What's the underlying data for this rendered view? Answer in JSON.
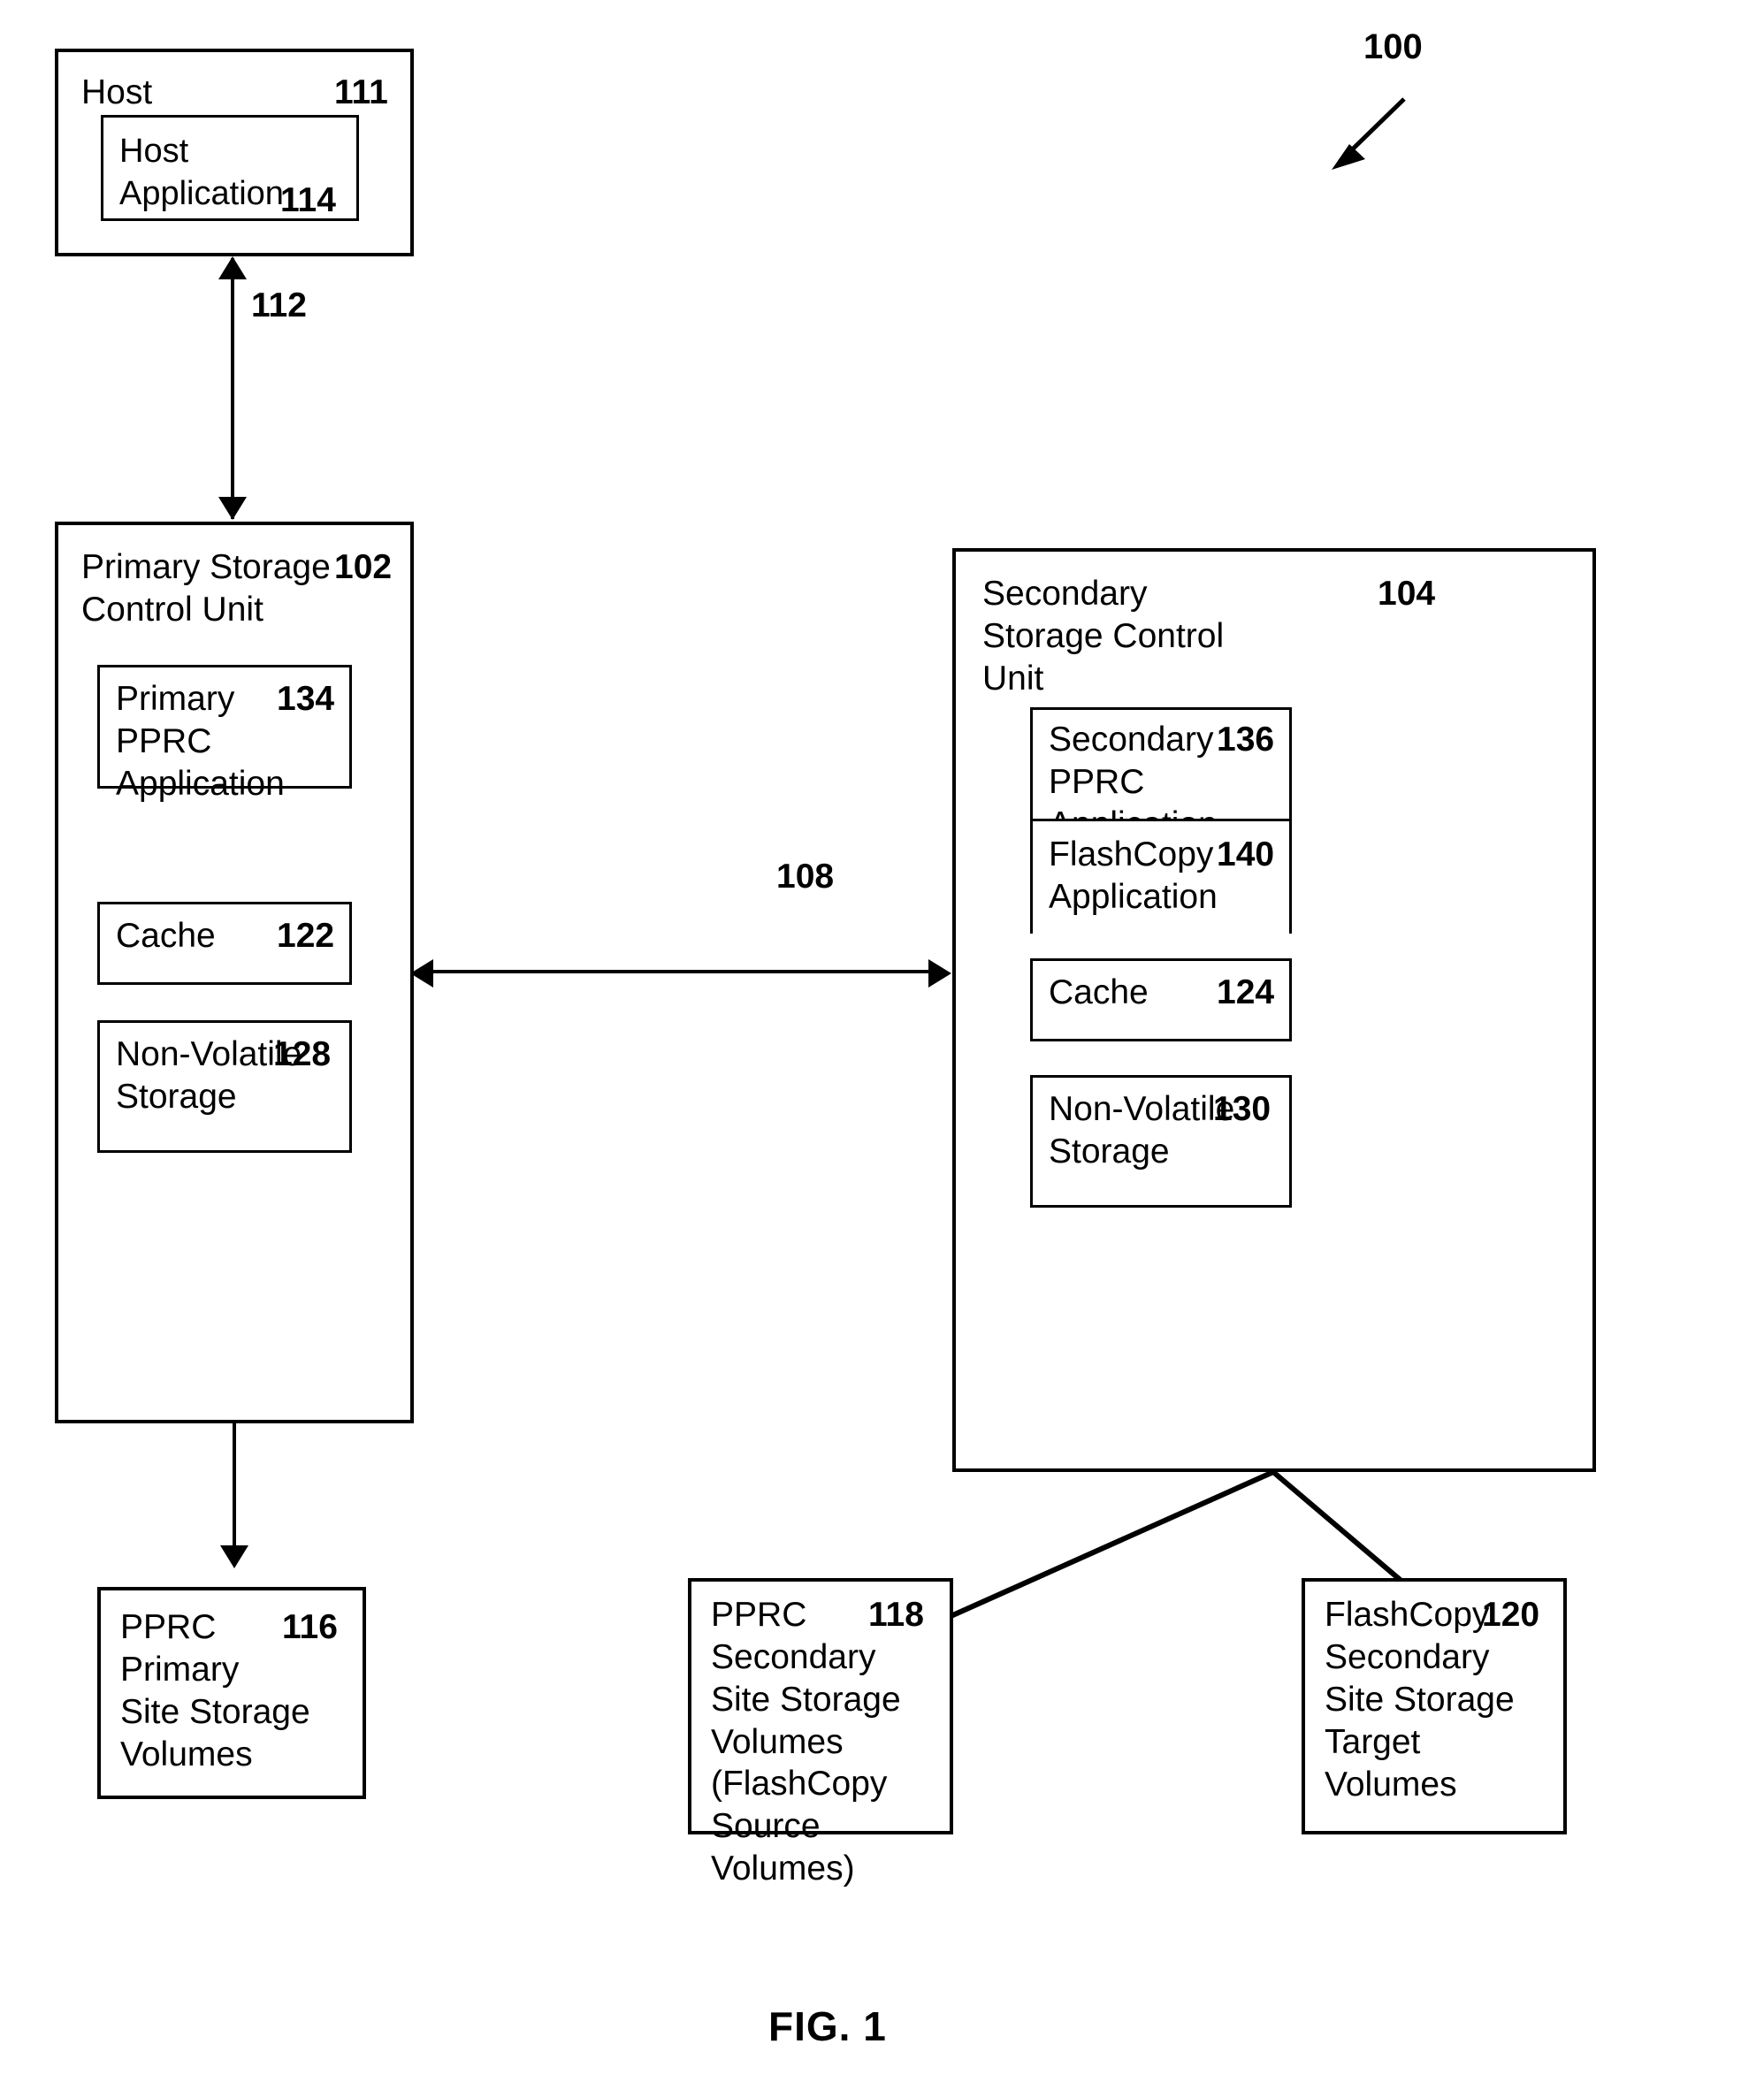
{
  "figure": {
    "caption": "FIG. 1",
    "system_ref": "100"
  },
  "nodes": {
    "host": {
      "label": "Host",
      "ref": "111"
    },
    "host_application": {
      "label": "Host   Application",
      "ref": "114"
    },
    "primary_storage_control_unit": {
      "label": "Primary Storage\nControl Unit",
      "ref": "102"
    },
    "primary_pprc_application": {
      "label": "Primary\nPPRC\nApplication",
      "ref": "134"
    },
    "primary_cache": {
      "label": "Cache",
      "ref": "122"
    },
    "primary_nvs": {
      "label": "Non-Volatile\nStorage",
      "ref": "128"
    },
    "secondary_storage_control_unit": {
      "label": "Secondary\nStorage Control\nUnit",
      "ref": "104"
    },
    "secondary_pprc_application": {
      "label": "Secondary\nPPRC\nApplication",
      "ref": "136"
    },
    "flashcopy_application": {
      "label": "FlashCopy\nApplication",
      "ref": "140"
    },
    "secondary_cache": {
      "label": "Cache",
      "ref": "124"
    },
    "secondary_nvs": {
      "label": "Non-Volatile\nStorage",
      "ref": "130"
    },
    "pprc_primary_volumes": {
      "label": "PPRC\nPrimary\nSite Storage\nVolumes",
      "ref": "116"
    },
    "pprc_secondary_volumes": {
      "label": "PPRC\nSecondary\nSite Storage\nVolumes",
      "label2": "(FlashCopy\nSource\nVolumes)",
      "ref": "118"
    },
    "flashcopy_target_volumes": {
      "label": "FlashCopy\nSecondary\nSite Storage\nTarget\nVolumes",
      "ref": "120"
    }
  },
  "connectors": {
    "host_to_primary": {
      "ref": "112"
    },
    "primary_to_secondary": {
      "ref": "108"
    }
  }
}
